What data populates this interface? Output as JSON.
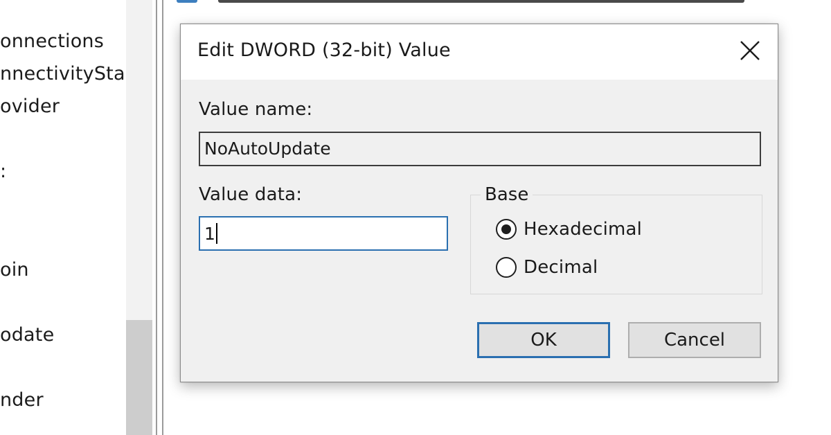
{
  "tree": {
    "items": [
      {
        "label": "onnections"
      },
      {
        "label": "nnectivitySta"
      },
      {
        "label": "ovider"
      },
      {
        "label": ":"
      },
      {
        "label": "oin"
      },
      {
        "label": "odate"
      },
      {
        "label": "nder"
      }
    ]
  },
  "dialog": {
    "title": "Edit DWORD (32-bit) Value",
    "close_icon": "close-icon",
    "value_name_label": "Value name:",
    "value_name": "NoAutoUpdate",
    "value_data_label": "Value data:",
    "value_data": "1",
    "base": {
      "legend": "Base",
      "options": [
        {
          "label": "Hexadecimal",
          "selected": true
        },
        {
          "label": "Decimal",
          "selected": false
        }
      ]
    },
    "ok_label": "OK",
    "cancel_label": "Cancel"
  },
  "colors": {
    "focus_border": "#2a6fb0",
    "dialog_bg": "#f0f0f0",
    "titlebar_bg": "#ffffff"
  }
}
